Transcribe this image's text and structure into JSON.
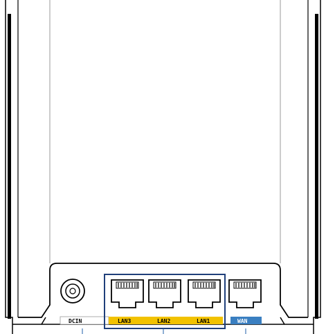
{
  "device": "router-rear-panel",
  "ports": [
    {
      "id": "dcin",
      "label": "DCIN",
      "type": "power-jack",
      "label_bg": "#ffffff",
      "label_fg": "#000000"
    },
    {
      "id": "lan3",
      "label": "LAN3",
      "type": "rj45",
      "label_bg": "#f2c200",
      "label_fg": "#000000"
    },
    {
      "id": "lan2",
      "label": "LAN2",
      "type": "rj45",
      "label_bg": "#f2c200",
      "label_fg": "#000000"
    },
    {
      "id": "lan1",
      "label": "LAN1",
      "type": "rj45",
      "label_bg": "#f2c200",
      "label_fg": "#000000"
    },
    {
      "id": "wan",
      "label": "WAN",
      "type": "rj45",
      "label_bg": "#3a7fc1",
      "label_fg": "#ffffff"
    }
  ],
  "highlight": {
    "group": [
      "lan3",
      "lan2",
      "lan1"
    ],
    "color": "#1f3f7a"
  },
  "colors": {
    "outline": "#000000",
    "panel_line": "#999999",
    "callout_line": "#1f5fa8"
  }
}
